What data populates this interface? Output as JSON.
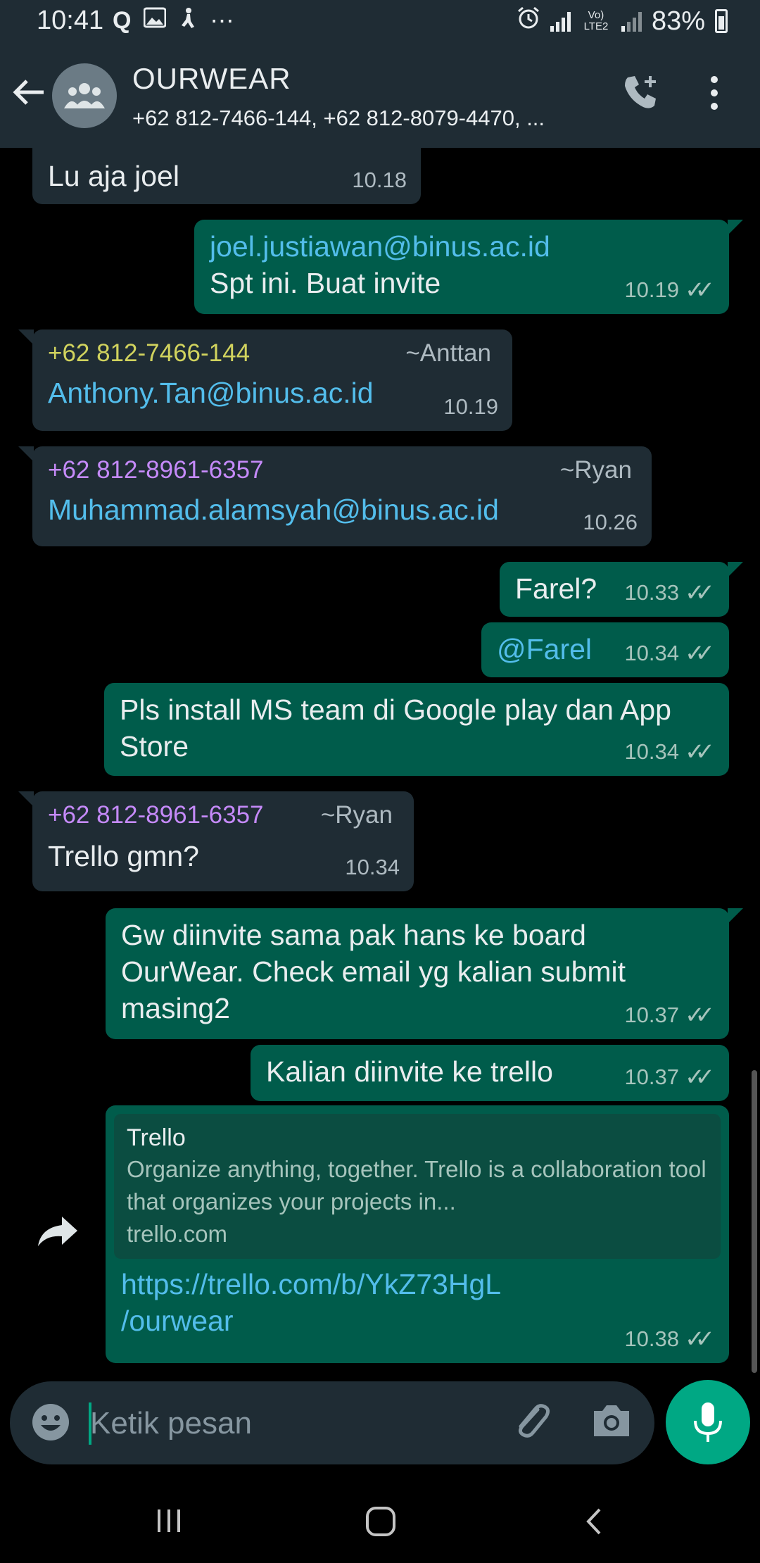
{
  "status_bar": {
    "time": "10:41",
    "network_label": "Vo) LTE2",
    "battery": "83%"
  },
  "header": {
    "title": "OURWEAR",
    "subtitle": "+62 812-7466-144, +62 812-8079-4470, ..."
  },
  "messages": [
    {
      "dir": "in",
      "text": "Lu aja joel",
      "time": "10.18"
    },
    {
      "dir": "out",
      "link": "joel.justiawan@binus.ac.id",
      "text": "Spt ini. Buat invite",
      "time": "10.19"
    },
    {
      "dir": "in",
      "phone": "+62 812-7466-144",
      "sender": "~Anttan",
      "link": "Anthony.Tan@binus.ac.id",
      "time": "10.19"
    },
    {
      "dir": "in",
      "phone": "+62 812-8961-6357",
      "sender": "~Ryan",
      "link": "Muhammad.alamsyah@binus.ac.id",
      "time": "10.26"
    },
    {
      "dir": "out",
      "text": "Farel?",
      "time": "10.33"
    },
    {
      "dir": "out",
      "link": "@Farel",
      "time": "10.34"
    },
    {
      "dir": "out",
      "text": "Pls install MS team di Google play dan App Store",
      "time": "10.34"
    },
    {
      "dir": "in",
      "phone": "+62 812-8961-6357",
      "sender": "~Ryan",
      "text": "Trello gmn?",
      "time": "10.34"
    },
    {
      "dir": "out",
      "text": "Gw diinvite sama pak hans ke board OurWear. Check email yg kalian submit masing2",
      "time": "10.37"
    },
    {
      "dir": "out",
      "text": "Kalian diinvite ke trello",
      "time": "10.37"
    },
    {
      "dir": "out",
      "preview_title": "Trello",
      "preview_desc": "Organize anything, together. Trello is a collaboration tool that organizes your projects in...",
      "preview_domain": "trello.com",
      "link": "https://trello.com/b/YkZ73HgL /ourwear",
      "time": "10.38"
    }
  ],
  "input": {
    "placeholder": "Ketik pesan"
  },
  "colors": {
    "incoming_bubble": "#1f2c34",
    "outgoing_bubble": "#005c4b",
    "accent": "#00a884",
    "link": "#53bdeb"
  }
}
